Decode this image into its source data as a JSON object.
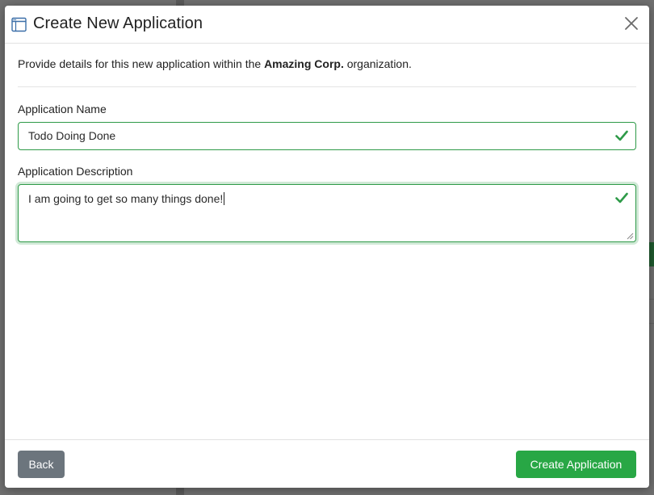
{
  "dialog": {
    "title": "Create New Application",
    "intro_prefix": "Provide details for this new application within the ",
    "organization": "Amazing Corp.",
    "intro_suffix": " organization."
  },
  "form": {
    "name_label": "Application Name",
    "name_value": "Todo Doing Done",
    "description_label": "Application Description",
    "description_value": "I am going to get so many things done!"
  },
  "footer": {
    "back_label": "Back",
    "create_label": "Create Application"
  },
  "colors": {
    "valid_green": "#2e9a48",
    "primary_green": "#28a745",
    "secondary_gray": "#6c757d"
  },
  "icons": {
    "title_icon": "window-icon",
    "close": "close-icon",
    "valid": "check-icon"
  }
}
